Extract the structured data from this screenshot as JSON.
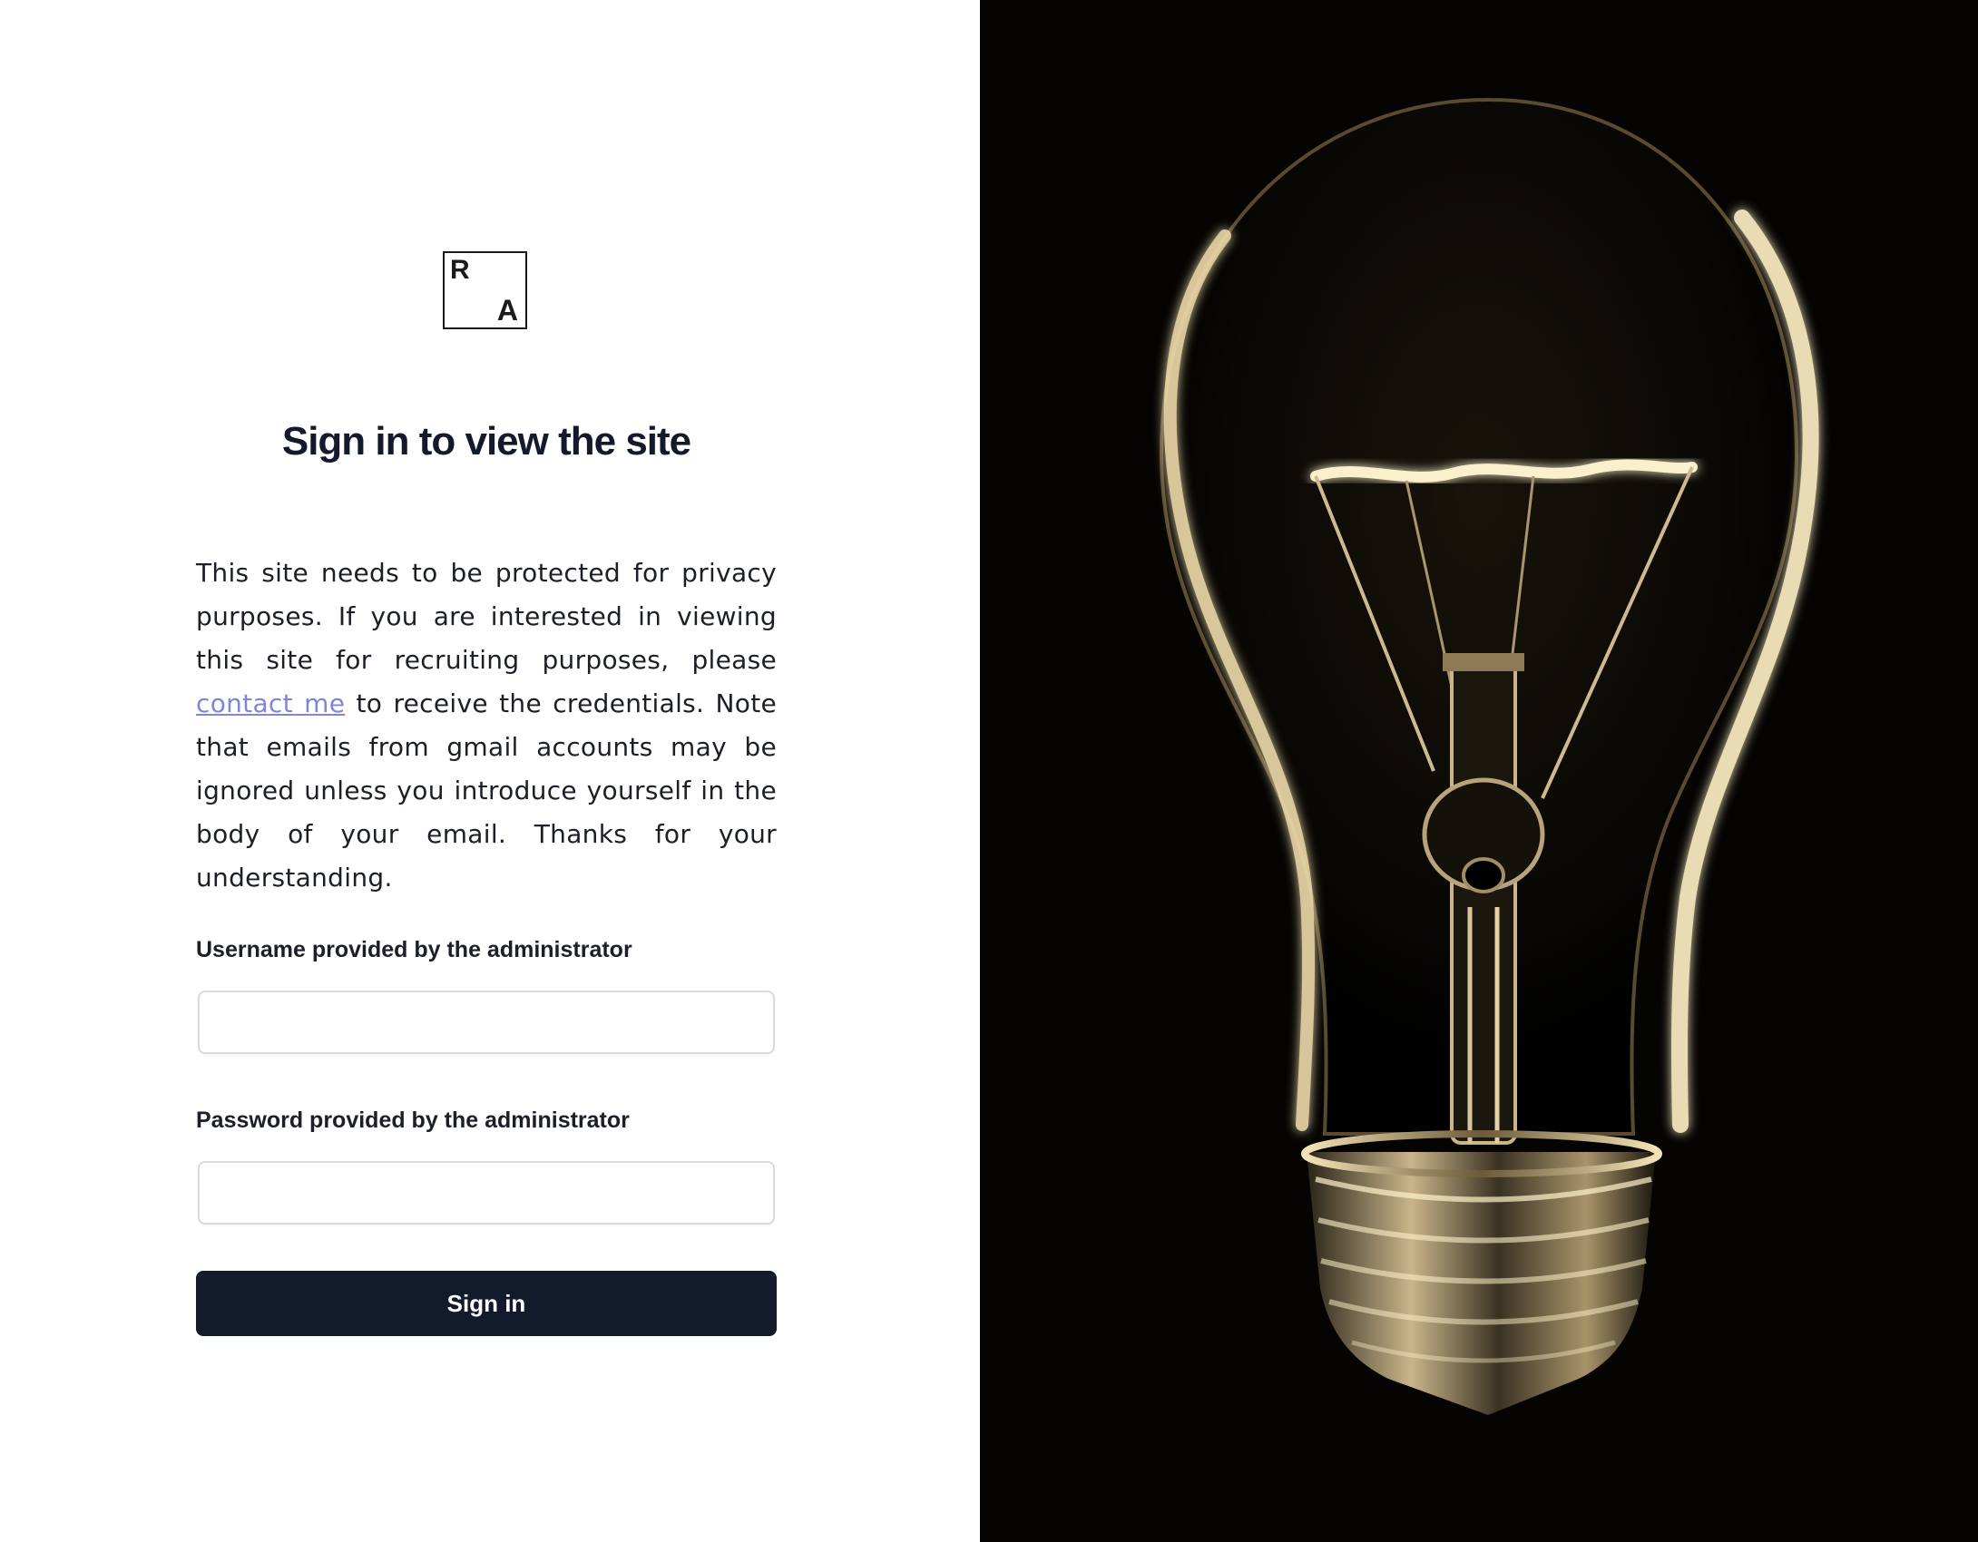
{
  "logo": {
    "letter_top": "R",
    "letter_bottom": "A"
  },
  "title": "Sign in to view the site",
  "intro": {
    "text_before_link": "This site needs to be protected for privacy purposes. If you are interested in viewing this site for recruiting purposes, please ",
    "link_text": "contact me",
    "text_after_link": " to receive the credentials. Note that emails from gmail accounts may be ignored unless you introduce yourself in the body of your email. Thanks for your understanding."
  },
  "form": {
    "username_label": "Username provided by the administrator",
    "username_value": "",
    "password_label": "Password provided by the administrator",
    "password_value": "",
    "submit_label": "Sign in"
  },
  "colors": {
    "button_bg": "#121a2c",
    "link": "#7f86d8",
    "photo_bg": "#000000",
    "filament_glow": "#f3e6c0"
  },
  "image": {
    "subject": "light-bulb-photo"
  }
}
